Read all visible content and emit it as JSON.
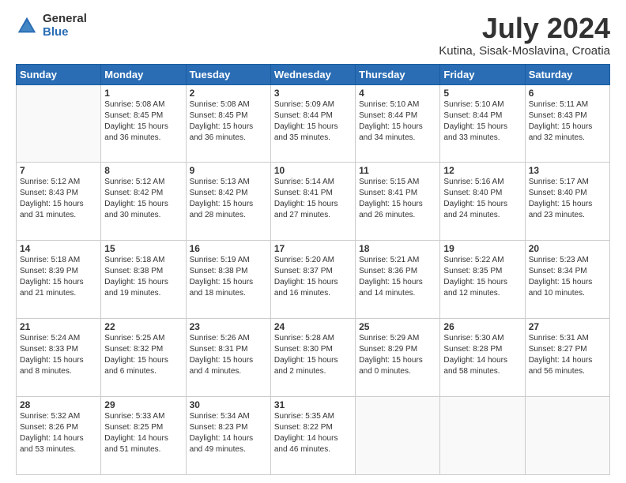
{
  "header": {
    "logo_general": "General",
    "logo_blue": "Blue",
    "title": "July 2024",
    "subtitle": "Kutina, Sisak-Moslavina, Croatia"
  },
  "days_of_week": [
    "Sunday",
    "Monday",
    "Tuesday",
    "Wednesday",
    "Thursday",
    "Friday",
    "Saturday"
  ],
  "weeks": [
    [
      {
        "day": "",
        "info": ""
      },
      {
        "day": "1",
        "info": "Sunrise: 5:08 AM\nSunset: 8:45 PM\nDaylight: 15 hours\nand 36 minutes."
      },
      {
        "day": "2",
        "info": "Sunrise: 5:08 AM\nSunset: 8:45 PM\nDaylight: 15 hours\nand 36 minutes."
      },
      {
        "day": "3",
        "info": "Sunrise: 5:09 AM\nSunset: 8:44 PM\nDaylight: 15 hours\nand 35 minutes."
      },
      {
        "day": "4",
        "info": "Sunrise: 5:10 AM\nSunset: 8:44 PM\nDaylight: 15 hours\nand 34 minutes."
      },
      {
        "day": "5",
        "info": "Sunrise: 5:10 AM\nSunset: 8:44 PM\nDaylight: 15 hours\nand 33 minutes."
      },
      {
        "day": "6",
        "info": "Sunrise: 5:11 AM\nSunset: 8:43 PM\nDaylight: 15 hours\nand 32 minutes."
      }
    ],
    [
      {
        "day": "7",
        "info": "Sunrise: 5:12 AM\nSunset: 8:43 PM\nDaylight: 15 hours\nand 31 minutes."
      },
      {
        "day": "8",
        "info": "Sunrise: 5:12 AM\nSunset: 8:42 PM\nDaylight: 15 hours\nand 30 minutes."
      },
      {
        "day": "9",
        "info": "Sunrise: 5:13 AM\nSunset: 8:42 PM\nDaylight: 15 hours\nand 28 minutes."
      },
      {
        "day": "10",
        "info": "Sunrise: 5:14 AM\nSunset: 8:41 PM\nDaylight: 15 hours\nand 27 minutes."
      },
      {
        "day": "11",
        "info": "Sunrise: 5:15 AM\nSunset: 8:41 PM\nDaylight: 15 hours\nand 26 minutes."
      },
      {
        "day": "12",
        "info": "Sunrise: 5:16 AM\nSunset: 8:40 PM\nDaylight: 15 hours\nand 24 minutes."
      },
      {
        "day": "13",
        "info": "Sunrise: 5:17 AM\nSunset: 8:40 PM\nDaylight: 15 hours\nand 23 minutes."
      }
    ],
    [
      {
        "day": "14",
        "info": "Sunrise: 5:18 AM\nSunset: 8:39 PM\nDaylight: 15 hours\nand 21 minutes."
      },
      {
        "day": "15",
        "info": "Sunrise: 5:18 AM\nSunset: 8:38 PM\nDaylight: 15 hours\nand 19 minutes."
      },
      {
        "day": "16",
        "info": "Sunrise: 5:19 AM\nSunset: 8:38 PM\nDaylight: 15 hours\nand 18 minutes."
      },
      {
        "day": "17",
        "info": "Sunrise: 5:20 AM\nSunset: 8:37 PM\nDaylight: 15 hours\nand 16 minutes."
      },
      {
        "day": "18",
        "info": "Sunrise: 5:21 AM\nSunset: 8:36 PM\nDaylight: 15 hours\nand 14 minutes."
      },
      {
        "day": "19",
        "info": "Sunrise: 5:22 AM\nSunset: 8:35 PM\nDaylight: 15 hours\nand 12 minutes."
      },
      {
        "day": "20",
        "info": "Sunrise: 5:23 AM\nSunset: 8:34 PM\nDaylight: 15 hours\nand 10 minutes."
      }
    ],
    [
      {
        "day": "21",
        "info": "Sunrise: 5:24 AM\nSunset: 8:33 PM\nDaylight: 15 hours\nand 8 minutes."
      },
      {
        "day": "22",
        "info": "Sunrise: 5:25 AM\nSunset: 8:32 PM\nDaylight: 15 hours\nand 6 minutes."
      },
      {
        "day": "23",
        "info": "Sunrise: 5:26 AM\nSunset: 8:31 PM\nDaylight: 15 hours\nand 4 minutes."
      },
      {
        "day": "24",
        "info": "Sunrise: 5:28 AM\nSunset: 8:30 PM\nDaylight: 15 hours\nand 2 minutes."
      },
      {
        "day": "25",
        "info": "Sunrise: 5:29 AM\nSunset: 8:29 PM\nDaylight: 15 hours\nand 0 minutes."
      },
      {
        "day": "26",
        "info": "Sunrise: 5:30 AM\nSunset: 8:28 PM\nDaylight: 14 hours\nand 58 minutes."
      },
      {
        "day": "27",
        "info": "Sunrise: 5:31 AM\nSunset: 8:27 PM\nDaylight: 14 hours\nand 56 minutes."
      }
    ],
    [
      {
        "day": "28",
        "info": "Sunrise: 5:32 AM\nSunset: 8:26 PM\nDaylight: 14 hours\nand 53 minutes."
      },
      {
        "day": "29",
        "info": "Sunrise: 5:33 AM\nSunset: 8:25 PM\nDaylight: 14 hours\nand 51 minutes."
      },
      {
        "day": "30",
        "info": "Sunrise: 5:34 AM\nSunset: 8:23 PM\nDaylight: 14 hours\nand 49 minutes."
      },
      {
        "day": "31",
        "info": "Sunrise: 5:35 AM\nSunset: 8:22 PM\nDaylight: 14 hours\nand 46 minutes."
      },
      {
        "day": "",
        "info": ""
      },
      {
        "day": "",
        "info": ""
      },
      {
        "day": "",
        "info": ""
      }
    ]
  ]
}
